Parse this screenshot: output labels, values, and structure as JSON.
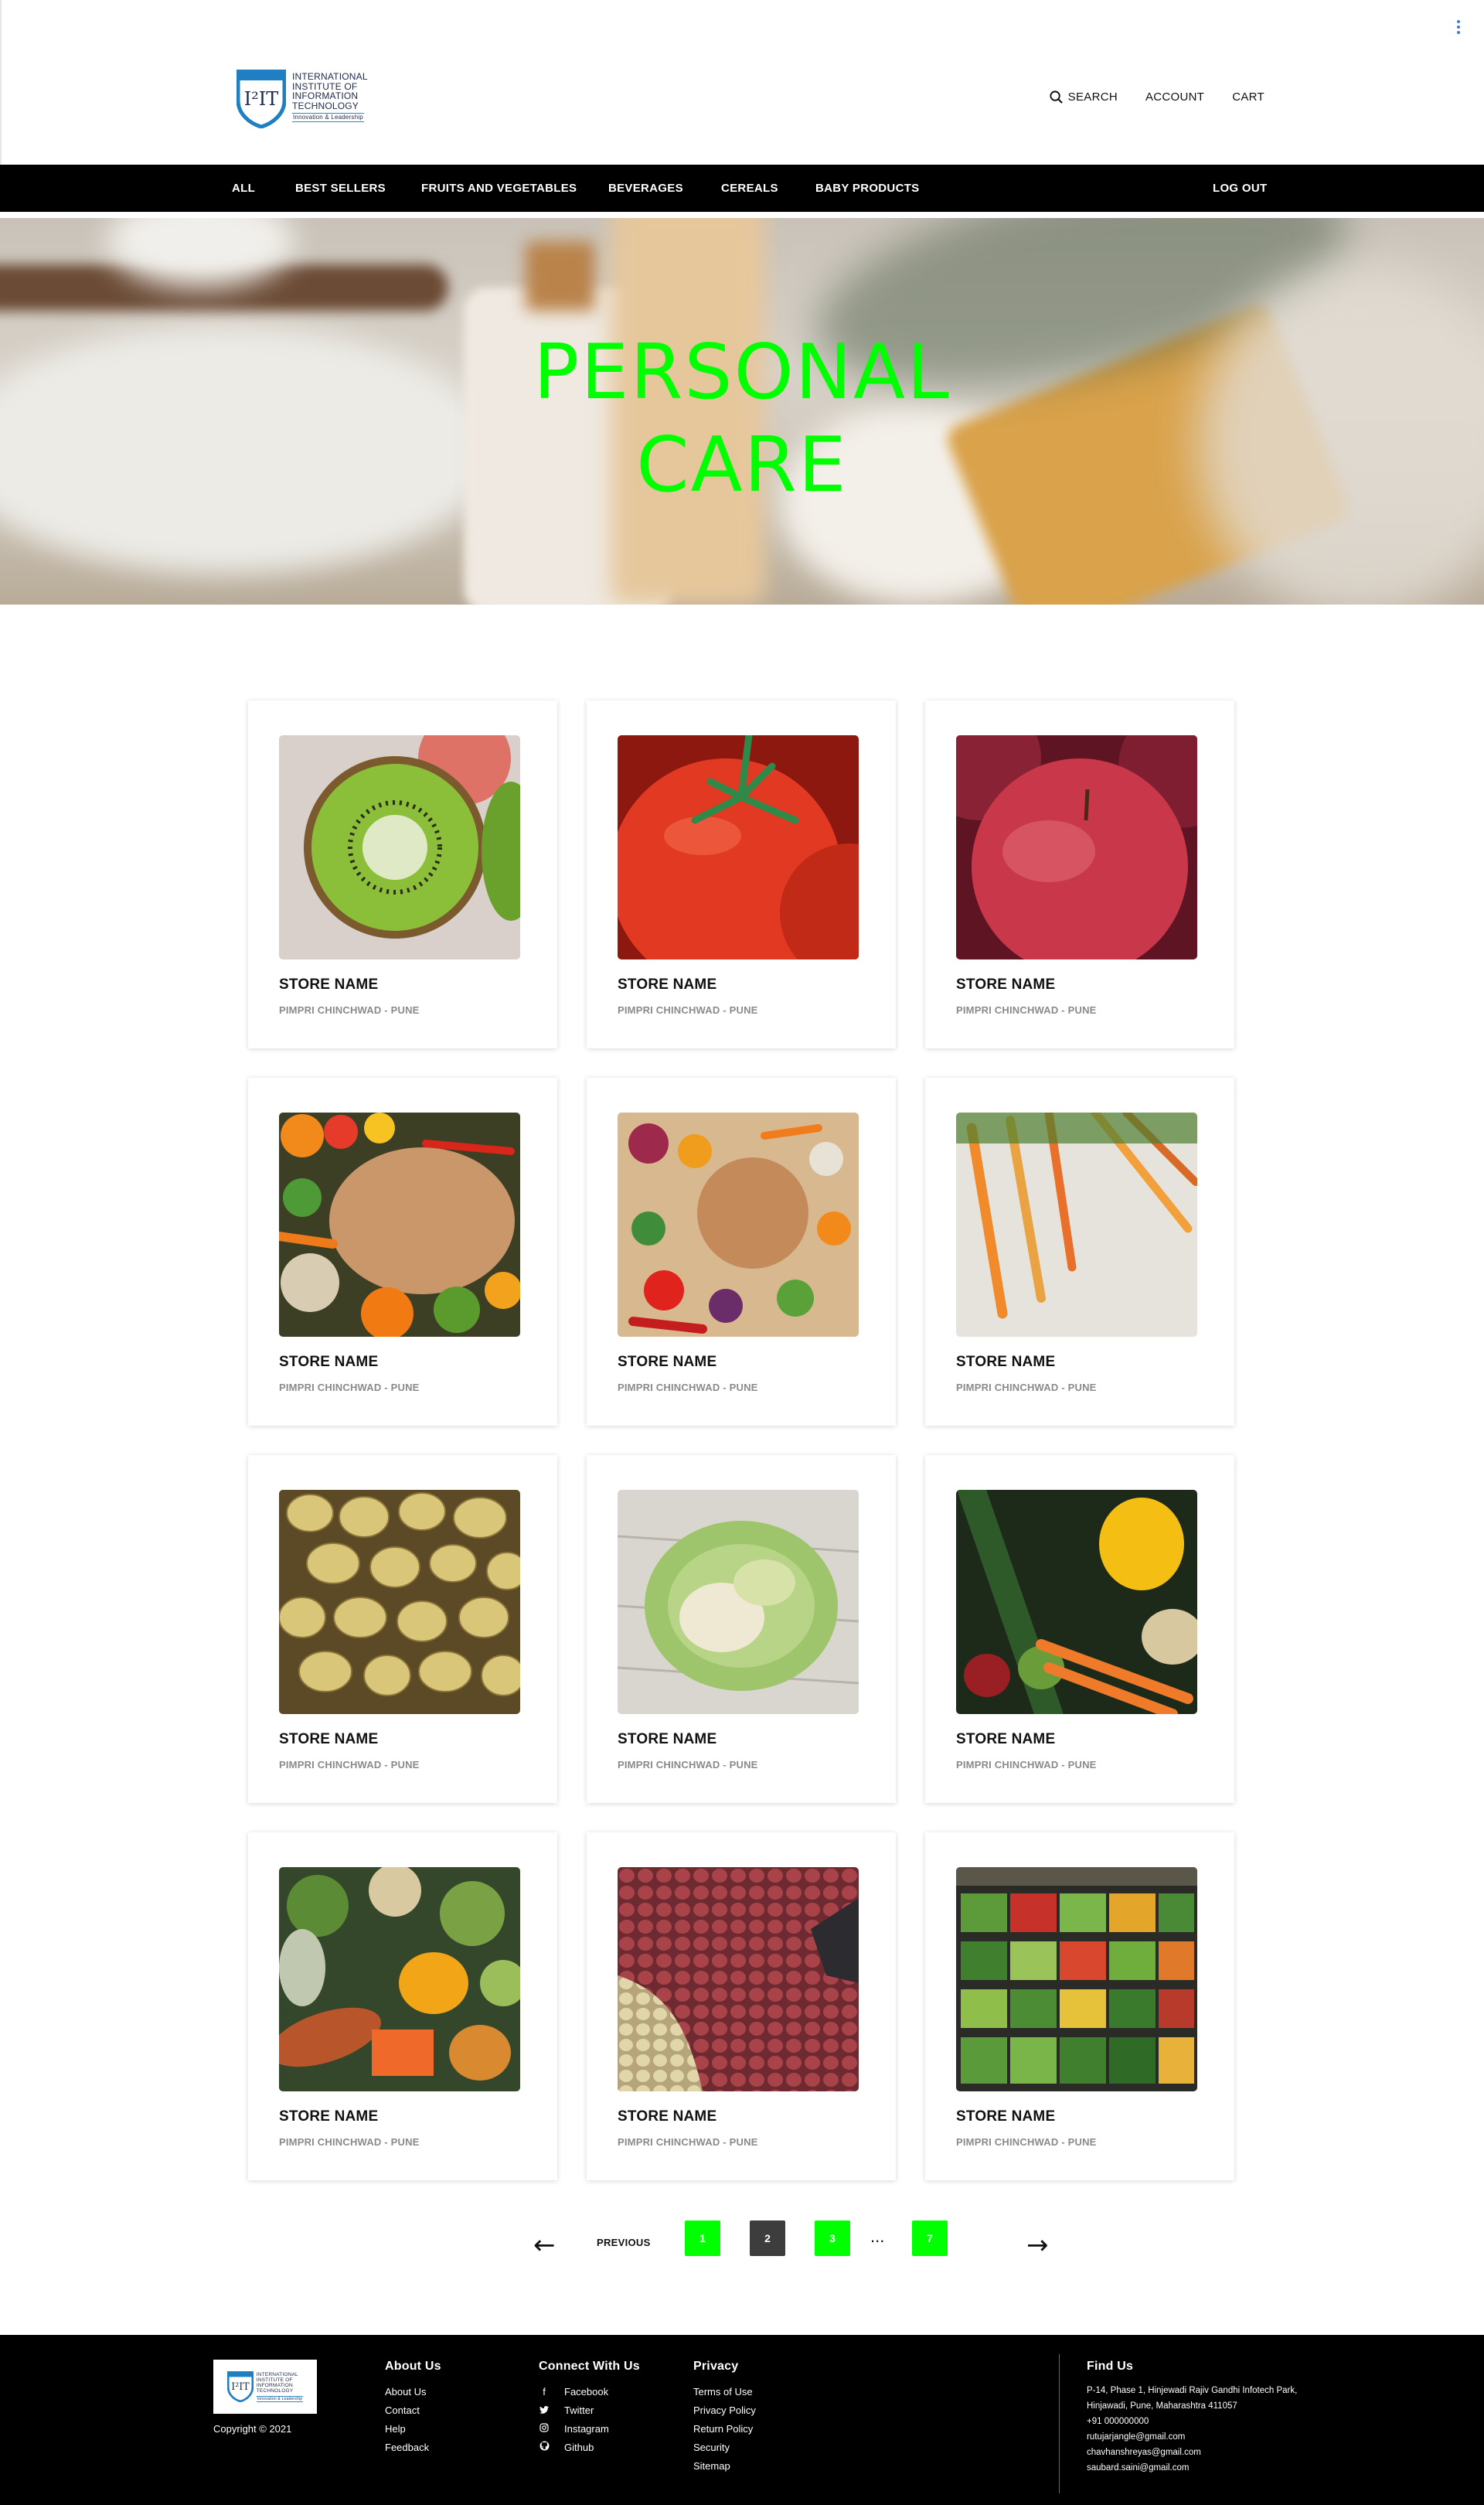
{
  "header": {
    "logo": {
      "lines": [
        "INTERNATIONAL",
        "INSTITUTE OF",
        "INFORMATION",
        "TECHNOLOGY"
      ],
      "tagline": "Innovation & Leadership",
      "mark": "I²IT"
    },
    "links": {
      "search": "SEARCH",
      "account": "ACCOUNT",
      "cart": "CART"
    }
  },
  "nav": {
    "items": [
      "ALL",
      "BEST SELLERS",
      "FRUITS AND VEGETABLES",
      "BEVERAGES",
      "CEREALS",
      "BABY PRODUCTS"
    ],
    "logout": "LOG OUT"
  },
  "hero": {
    "title_line1": "PERSONAL",
    "title_line2": "CARE"
  },
  "cards": [
    {
      "image": "kiwi",
      "title": "STORE NAME",
      "subtitle": "PIMPRI CHINCHWAD - PUNE"
    },
    {
      "image": "tomato",
      "title": "STORE NAME",
      "subtitle": "PIMPRI CHINCHWAD - PUNE"
    },
    {
      "image": "apple",
      "title": "STORE NAME",
      "subtitle": "PIMPRI CHINCHWAD - PUNE"
    },
    {
      "image": "vegetables-around-board",
      "title": "STORE NAME",
      "subtitle": "PIMPRI CHINCHWAD - PUNE"
    },
    {
      "image": "vegetables-circle",
      "title": "STORE NAME",
      "subtitle": "PIMPRI CHINCHWAD - PUNE"
    },
    {
      "image": "carrots",
      "title": "STORE NAME",
      "subtitle": "PIMPRI CHINCHWAD - PUNE"
    },
    {
      "image": "potatoes",
      "title": "STORE NAME",
      "subtitle": "PIMPRI CHINCHWAD - PUNE"
    },
    {
      "image": "cauliflower",
      "title": "STORE NAME",
      "subtitle": "PIMPRI CHINCHWAD - PUNE"
    },
    {
      "image": "mixed-vegetables",
      "title": "STORE NAME",
      "subtitle": "PIMPRI CHINCHWAD - PUNE"
    },
    {
      "image": "assorted-vegetables",
      "title": "STORE NAME",
      "subtitle": "PIMPRI CHINCHWAD - PUNE"
    },
    {
      "image": "onions-potatoes",
      "title": "STORE NAME",
      "subtitle": "PIMPRI CHINCHWAD - PUNE"
    },
    {
      "image": "produce-shelves",
      "title": "STORE NAME",
      "subtitle": "PIMPRI CHINCHWAD - PUNE"
    }
  ],
  "pagination": {
    "prev_label": "PREVIOUS",
    "pages": [
      "1",
      "2",
      "3",
      "7"
    ],
    "current_page": "2",
    "ellipsis": "...",
    "prev_arrow": "←",
    "next_arrow": "→"
  },
  "footer": {
    "copyright": "Copyright © 2021",
    "about": {
      "heading": "About Us",
      "links": [
        "About Us",
        "Contact",
        "Help",
        "Feedback"
      ]
    },
    "connect": {
      "heading": "Connect With Us",
      "links": [
        {
          "icon": "facebook-icon",
          "label": "Facebook"
        },
        {
          "icon": "twitter-icon",
          "label": "Twitter"
        },
        {
          "icon": "instagram-icon",
          "label": "Instagram"
        },
        {
          "icon": "github-icon",
          "label": "Github"
        }
      ]
    },
    "privacy": {
      "heading": "Privacy",
      "links": [
        "Terms of Use",
        "Privacy Policy",
        "Return Policy",
        "Security",
        "Sitemap"
      ]
    },
    "find": {
      "heading": "Find Us",
      "lines": [
        "P-14, Phase 1, Hinjewadi Rajiv Gandhi Infotech Park,",
        "Hinjawadi, Pune, Maharashtra 411057",
        "+91 000000000",
        "rutujarjangle@gmail.com",
        "chavhanshreyas@gmail.com",
        "saubard.saini@gmail.com"
      ]
    }
  },
  "colors": {
    "accent": "#00ff00",
    "nav_bg": "#000000",
    "footer_bg": "#000000",
    "page_btn_dark": "#3d3d3d"
  }
}
